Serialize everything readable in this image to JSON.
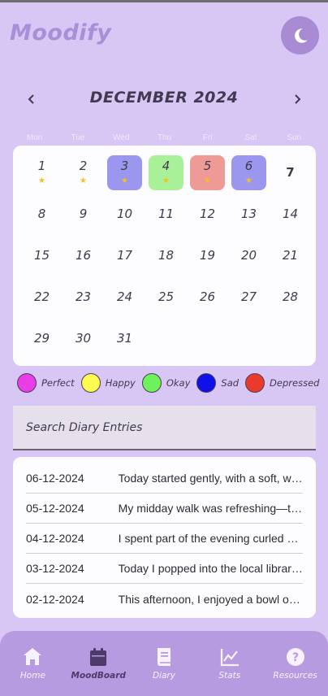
{
  "app": {
    "title": "Moodify"
  },
  "header": {
    "theme_icon": "moon-icon"
  },
  "calendar": {
    "month_title": "DECEMBER 2024",
    "prev_icon": "chevron-left-icon",
    "next_icon": "chevron-right-icon",
    "weekdays": [
      "Mon",
      "Tue",
      "Wed",
      "Thu",
      "Fri",
      "Sat",
      "Sun"
    ],
    "days": [
      {
        "n": "1",
        "mood": "none",
        "star": true
      },
      {
        "n": "2",
        "mood": "none",
        "star": true
      },
      {
        "n": "3",
        "mood": "sad",
        "star": true
      },
      {
        "n": "4",
        "mood": "okay",
        "star": true
      },
      {
        "n": "5",
        "mood": "depressed",
        "star": true
      },
      {
        "n": "6",
        "mood": "sad",
        "star": true
      },
      {
        "n": "7",
        "mood": "today",
        "star": false
      },
      {
        "n": "8"
      },
      {
        "n": "9"
      },
      {
        "n": "10"
      },
      {
        "n": "11"
      },
      {
        "n": "12"
      },
      {
        "n": "13"
      },
      {
        "n": "14"
      },
      {
        "n": "15"
      },
      {
        "n": "16"
      },
      {
        "n": "17"
      },
      {
        "n": "18"
      },
      {
        "n": "19"
      },
      {
        "n": "20"
      },
      {
        "n": "21"
      },
      {
        "n": "22"
      },
      {
        "n": "23"
      },
      {
        "n": "24"
      },
      {
        "n": "25"
      },
      {
        "n": "26"
      },
      {
        "n": "27"
      },
      {
        "n": "28"
      },
      {
        "n": "29"
      },
      {
        "n": "30"
      },
      {
        "n": "31"
      }
    ],
    "star_glyph": "★",
    "mood_colors": {
      "sad": "#9c97ee",
      "okay": "#a9f198",
      "depressed": "#ee9a97",
      "none": "#fdfcfe"
    }
  },
  "legend": [
    {
      "label": "Perfect",
      "color": "#e93de8"
    },
    {
      "label": "Happy",
      "color": "#fdfb4f"
    },
    {
      "label": "Okay",
      "color": "#6ef25c"
    },
    {
      "label": "Sad",
      "color": "#1010e8"
    },
    {
      "label": "Depressed",
      "color": "#ea3a2c"
    }
  ],
  "search": {
    "placeholder": "Search Diary Entries"
  },
  "entries": [
    {
      "date": "06-12-2024",
      "text": "Today started gently, with a soft, warm morning"
    },
    {
      "date": "05-12-2024",
      "text": "My midday walk was refreshing—the air was crisp"
    },
    {
      "date": "04-12-2024",
      "text": "I spent part of the evening curled up with a book"
    },
    {
      "date": "03-12-2024",
      "text": "Today I popped into the local library for a while"
    },
    {
      "date": "02-12-2024",
      "text": "This afternoon, I enjoyed a bowl of warm soup"
    }
  ],
  "nav": [
    {
      "label": "Home",
      "icon": "home-icon",
      "active": false
    },
    {
      "label": "MoodBoard",
      "icon": "calendar-icon",
      "active": true
    },
    {
      "label": "Diary",
      "icon": "book-icon",
      "active": false
    },
    {
      "label": "Stats",
      "icon": "chart-icon",
      "active": false
    },
    {
      "label": "Resources",
      "icon": "help-icon",
      "active": false
    }
  ]
}
